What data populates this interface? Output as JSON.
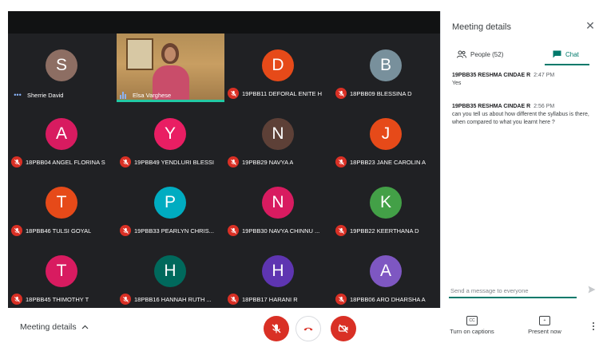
{
  "participants": [
    {
      "initial": "S",
      "name": "Sherrie David",
      "color": "#8d6e63",
      "status": "speaking"
    },
    {
      "initial": "",
      "name": "Elsa Varghese",
      "color": "#c89e62",
      "status": "video"
    },
    {
      "initial": "D",
      "name": "19PBB11 DEFORAL ENITE H",
      "color": "#e64a19",
      "status": "muted"
    },
    {
      "initial": "B",
      "name": "18PBB09 BLESSINA D",
      "color": "#78909c",
      "status": "muted"
    },
    {
      "initial": "A",
      "name": "18PBB04 ANGEL FLORINA S",
      "color": "#d81b60",
      "status": "muted"
    },
    {
      "initial": "Y",
      "name": "19PBB49 YENDLURI BLESSI",
      "color": "#e91e63",
      "status": "muted"
    },
    {
      "initial": "N",
      "name": "19PBB29 NAVYA A",
      "color": "#5d4037",
      "status": "muted"
    },
    {
      "initial": "J",
      "name": "18PBB23 JANE CAROLIN A",
      "color": "#e64a19",
      "status": "muted"
    },
    {
      "initial": "T",
      "name": "18PBB46 TULSI GOYAL",
      "color": "#e64a19",
      "status": "muted"
    },
    {
      "initial": "P",
      "name": "19PBB33 PEARLYN CHRIS...",
      "color": "#00acc1",
      "status": "muted"
    },
    {
      "initial": "N",
      "name": "19PBB30 NAVYA CHINNU ...",
      "color": "#d81b60",
      "status": "muted"
    },
    {
      "initial": "K",
      "name": "19PBB22 KEERTHANA D",
      "color": "#43a047",
      "status": "muted"
    },
    {
      "initial": "T",
      "name": "18PBB45 THIMOTHY T",
      "color": "#d81b60",
      "status": "muted"
    },
    {
      "initial": "H",
      "name": "18PBB16 HANNAH RUTH ...",
      "color": "#00695c",
      "status": "muted"
    },
    {
      "initial": "H",
      "name": "18PBB17 HARANI R",
      "color": "#5e35b1",
      "status": "muted"
    },
    {
      "initial": "A",
      "name": "18PBB06 ARO DHARSHA A",
      "color": "#7e57c2",
      "status": "muted"
    }
  ],
  "panel": {
    "title": "Meeting details",
    "tab_people": "People (52)",
    "tab_chat": "Chat",
    "messages": [
      {
        "sender": "19PBB35 RESHMA CINDAE R",
        "time": "2:47 PM",
        "text": "Yes"
      },
      {
        "sender": "19PBB35 RESHMA CINDAE R",
        "time": "2:56 PM",
        "text": "can you tell us about how different the syllabus is there, when compared to what you learnt here ?"
      }
    ],
    "compose_placeholder": "Send a message to everyone"
  },
  "bottom": {
    "meeting_details": "Meeting details",
    "captions_label": "Turn on captions",
    "captions_icon_text": "CC",
    "present_label": "Present now"
  },
  "colors": {
    "accent": "#00796b",
    "danger": "#d93025",
    "tile_bg": "#202124"
  }
}
